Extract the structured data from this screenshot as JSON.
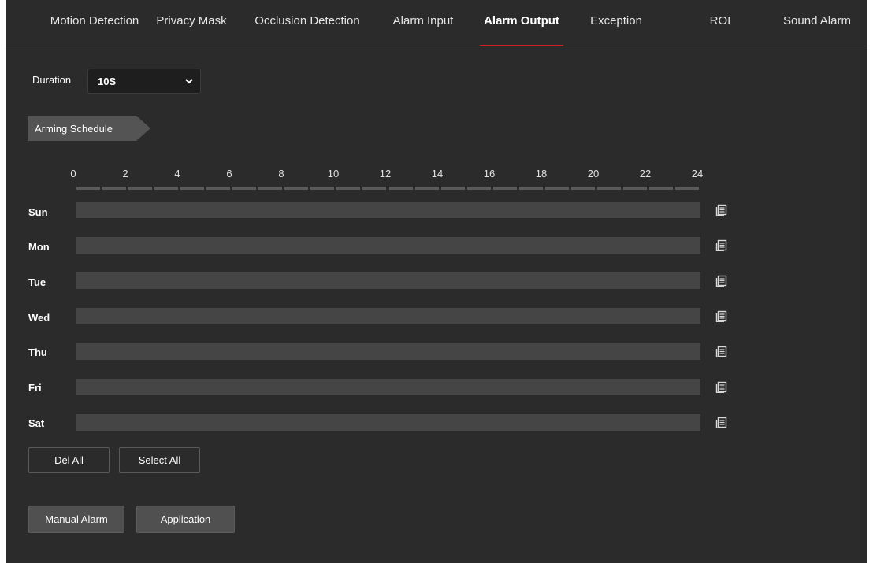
{
  "tabs": [
    {
      "label": "Motion Detection",
      "active": false
    },
    {
      "label": "Privacy Mask",
      "active": false
    },
    {
      "label": "Occlusion Detection",
      "active": false
    },
    {
      "label": "Alarm Input",
      "active": false
    },
    {
      "label": "Alarm Output",
      "active": true
    },
    {
      "label": "Exception",
      "active": false
    },
    {
      "label": "ROI",
      "active": false
    },
    {
      "label": "Sound Alarm",
      "active": false
    }
  ],
  "duration": {
    "label": "Duration",
    "value": "10S"
  },
  "schedule": {
    "title": "Arming Schedule",
    "hours": [
      "0",
      "2",
      "4",
      "6",
      "8",
      "10",
      "12",
      "14",
      "16",
      "18",
      "20",
      "22",
      "24"
    ],
    "days": [
      "Sun",
      "Mon",
      "Tue",
      "Wed",
      "Thu",
      "Fri",
      "Sat"
    ]
  },
  "buttons": {
    "del_all": "Del All",
    "select_all": "Select All",
    "manual_alarm": "Manual Alarm",
    "application": "Application"
  },
  "colors": {
    "background": "#2b2b2b",
    "active_tab_underline": "#d0202a",
    "schedule_bar": "#454545"
  },
  "icons": {
    "dropdown": "chevron-down-icon",
    "copy_schedule": "copy-schedule-icon"
  }
}
